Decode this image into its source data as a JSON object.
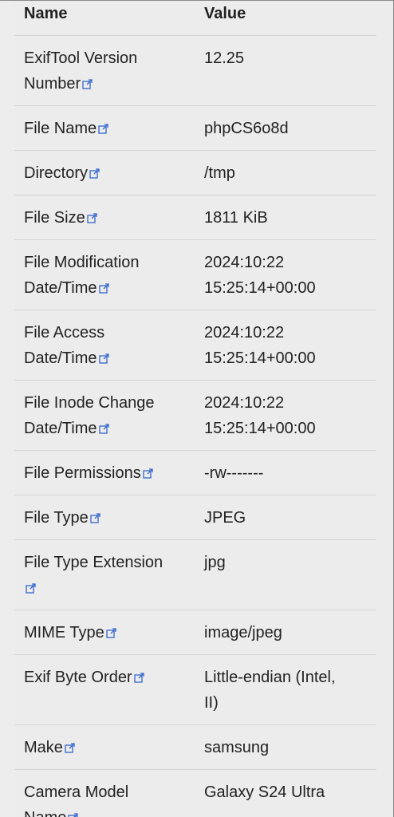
{
  "table": {
    "headers": {
      "name": "Name",
      "value": "Value"
    },
    "rows": [
      {
        "name_parts": [
          "ExifTool Version",
          "Number"
        ],
        "value_parts": [
          "12.25"
        ]
      },
      {
        "name_parts": [
          "File Name"
        ],
        "value_parts": [
          "phpCS6o8d"
        ]
      },
      {
        "name_parts": [
          "Directory"
        ],
        "value_parts": [
          "/tmp"
        ]
      },
      {
        "name_parts": [
          "File Size"
        ],
        "value_parts": [
          "1811 KiB"
        ]
      },
      {
        "name_parts": [
          "File Modification",
          "Date/Time"
        ],
        "value_parts": [
          "2024:10:22",
          "15:25:14+00:00"
        ]
      },
      {
        "name_parts": [
          "File Access",
          "Date/Time"
        ],
        "value_parts": [
          "2024:10:22",
          "15:25:14+00:00"
        ]
      },
      {
        "name_parts": [
          "File Inode Change",
          "Date/Time"
        ],
        "value_parts": [
          "2024:10:22",
          "15:25:14+00:00"
        ]
      },
      {
        "name_parts": [
          "File Permissions"
        ],
        "value_parts": [
          "-rw-------"
        ]
      },
      {
        "name_parts": [
          "File Type"
        ],
        "value_parts": [
          "JPEG"
        ]
      },
      {
        "name_parts": [
          "File Type Extension",
          ""
        ],
        "value_parts": [
          "jpg"
        ]
      },
      {
        "name_parts": [
          "MIME Type"
        ],
        "value_parts": [
          "image/jpeg"
        ]
      },
      {
        "name_parts": [
          "Exif Byte Order"
        ],
        "value_parts": [
          "Little-endian (Intel,",
          "II)"
        ]
      },
      {
        "name_parts": [
          "Make"
        ],
        "value_parts": [
          "samsung"
        ]
      },
      {
        "name_parts": [
          "Camera Model",
          "Name"
        ],
        "value_parts": [
          "Galaxy S24 Ultra"
        ]
      }
    ]
  },
  "icons": {
    "link": "external-link-icon"
  },
  "colors": {
    "background": "#ececec",
    "text": "#222222",
    "link_icon": "#3366cc",
    "divider": "#d4d4d4"
  }
}
